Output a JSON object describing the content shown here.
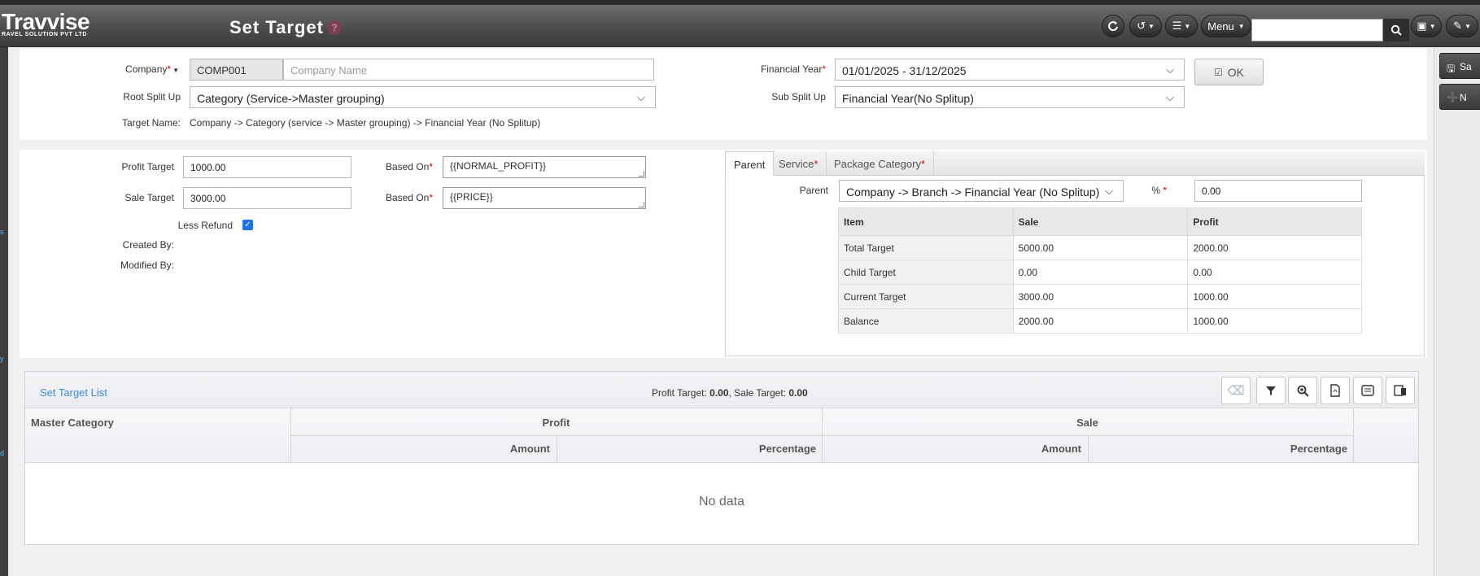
{
  "brand": {
    "name": "Travvise",
    "tagline": "RAVEL SOLUTION PVT LTD"
  },
  "header": {
    "title": "Set Target",
    "help_glyph": "?",
    "menu_label": "Menu",
    "search_value": ""
  },
  "left_bar": {
    "glyphs": [
      "s",
      "y",
      "d"
    ]
  },
  "side_actions": {
    "save": "Sa",
    "new": "N"
  },
  "form": {
    "company_label": "Company",
    "company_code": "COMP001",
    "company_name_placeholder": "Company Name",
    "root_split_label": "Root Split Up",
    "root_split_value": "Category (Service->Master grouping)",
    "target_name_label": "Target Name:",
    "target_name_value": "Company -> Category (service -> Master grouping) -> Financial Year (No Splitup)",
    "financial_year_label": "Financial Year",
    "financial_year_value": "01/01/2025 - 31/12/2025",
    "sub_split_label": "Sub Split Up",
    "sub_split_value": "Financial Year(No Splitup)",
    "ok_label": "OK"
  },
  "targets": {
    "profit_target_label": "Profit Target",
    "profit_target_value": "1000.00",
    "sale_target_label": "Sale Target",
    "sale_target_value": "3000.00",
    "based_on_label": "Based On",
    "profit_based_on": "{{NORMAL_PROFIT}}",
    "sale_based_on": "{{PRICE}}",
    "less_refund_label": "Less Refund",
    "less_refund_checked": true,
    "created_by_label": "Created By:",
    "modified_by_label": "Modified By:"
  },
  "parent_panel": {
    "tabs": [
      {
        "label": "Parent",
        "required": false
      },
      {
        "label": "Service",
        "required": true
      },
      {
        "label": "Package Category",
        "required": true
      }
    ],
    "parent_label": "Parent",
    "parent_value": "Company -> Branch -> Financial Year (No Splitup)",
    "percent_label": "%",
    "percent_value": "0.00",
    "table": {
      "headers": [
        "Item",
        "Sale",
        "Profit"
      ],
      "rows": [
        [
          "Total Target",
          "5000.00",
          "2000.00"
        ],
        [
          "Child Target",
          "0.00",
          "0.00"
        ],
        [
          "Current Target",
          "3000.00",
          "1000.00"
        ],
        [
          "Balance",
          "2000.00",
          "1000.00"
        ]
      ]
    }
  },
  "list": {
    "title": "Set Target List",
    "summary_profit_label": "Profit Target:",
    "summary_profit_value": "0.00",
    "summary_sale_label": "Sale Target:",
    "summary_sale_value": "0.00",
    "columns": {
      "master_category": "Master Category",
      "profit": "Profit",
      "sale": "Sale",
      "amount": "Amount",
      "percentage": "Percentage"
    },
    "empty_text": "No data"
  }
}
